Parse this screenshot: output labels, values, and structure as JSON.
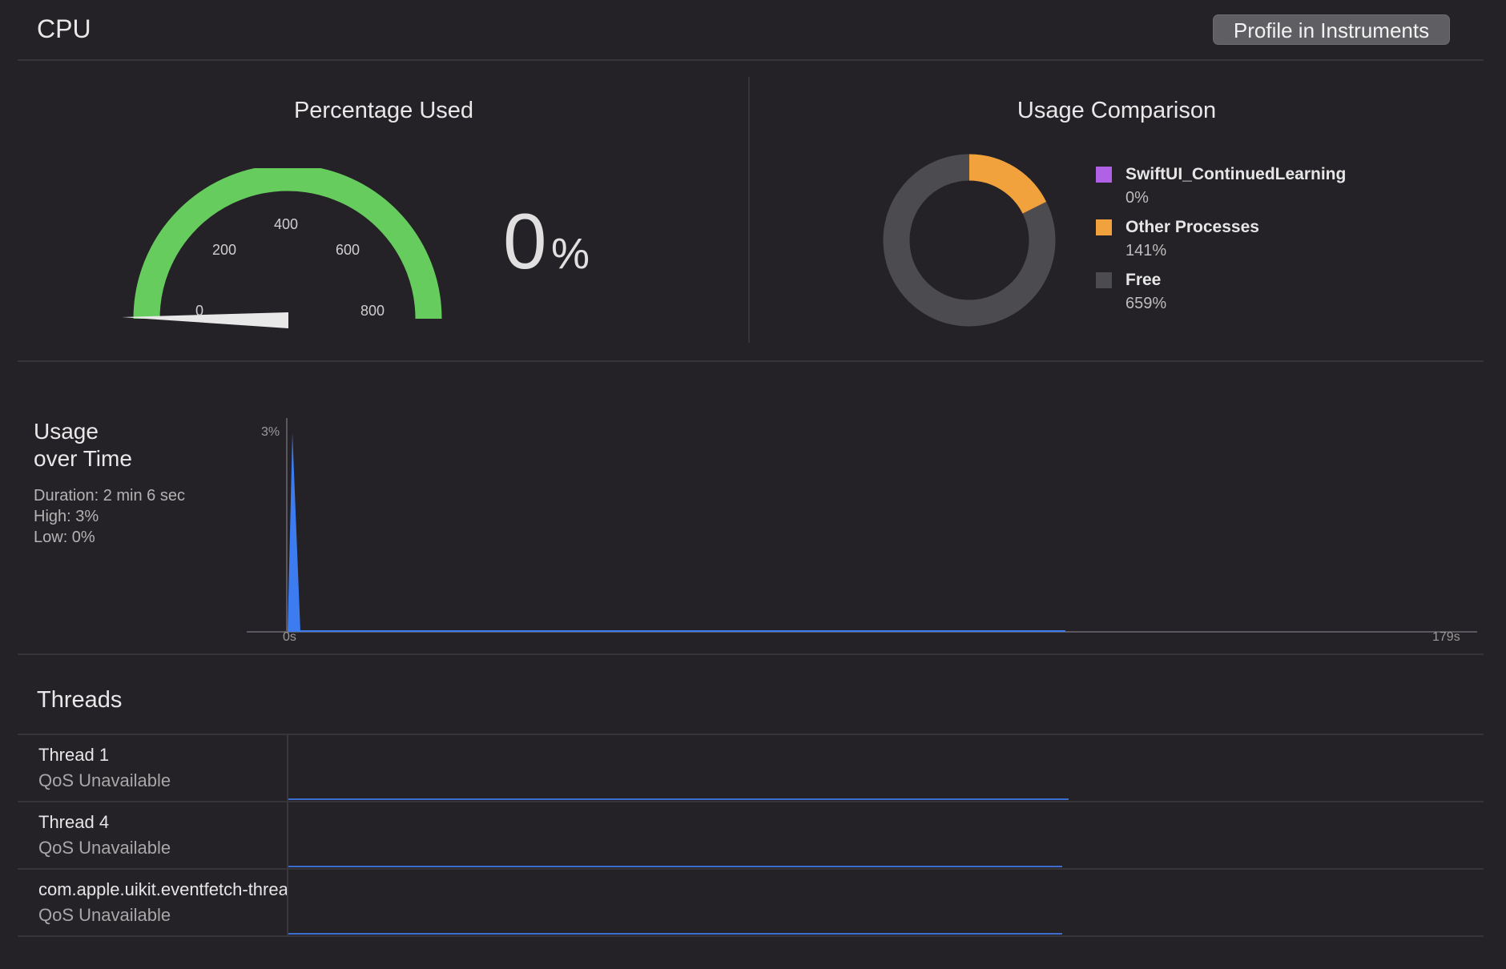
{
  "header": {
    "title": "CPU",
    "profile_button": "Profile in Instruments"
  },
  "gauge": {
    "title": "Percentage Used",
    "ticks": [
      "0",
      "200",
      "400",
      "600",
      "800"
    ],
    "value": "0",
    "unit": "%",
    "max": 800,
    "current": 0,
    "color": "#66cc5e"
  },
  "comparison": {
    "title": "Usage Comparison",
    "legend": [
      {
        "name": "SwiftUI_ContinuedLearning",
        "value": "0%",
        "color": "#b061e6"
      },
      {
        "name": "Other Processes",
        "value": "141%",
        "color": "#f2a23c"
      },
      {
        "name": "Free",
        "value": "659%",
        "color": "#4c4b4f"
      }
    ]
  },
  "chart_data": {
    "type": "pie",
    "categories": [
      "SwiftUI_ContinuedLearning",
      "Other Processes",
      "Free"
    ],
    "values": [
      0,
      141,
      659
    ]
  },
  "usage_over_time": {
    "title_line1": "Usage",
    "title_line2": "over Time",
    "duration": "Duration: 2 min 6 sec",
    "high": "High: 3%",
    "low": "Low: 0%",
    "y_max_label": "3%",
    "x_start_label": "0s",
    "x_end_label": "179s",
    "accent": "#3d7cf0"
  },
  "threads": {
    "title": "Threads",
    "rows": [
      {
        "name": "Thread 1",
        "qos": "QoS Unavailable"
      },
      {
        "name": "Thread 4",
        "qos": "QoS Unavailable"
      },
      {
        "name": "com.apple.uikit.eventfetch-thread",
        "qos": "QoS Unavailable"
      }
    ]
  }
}
